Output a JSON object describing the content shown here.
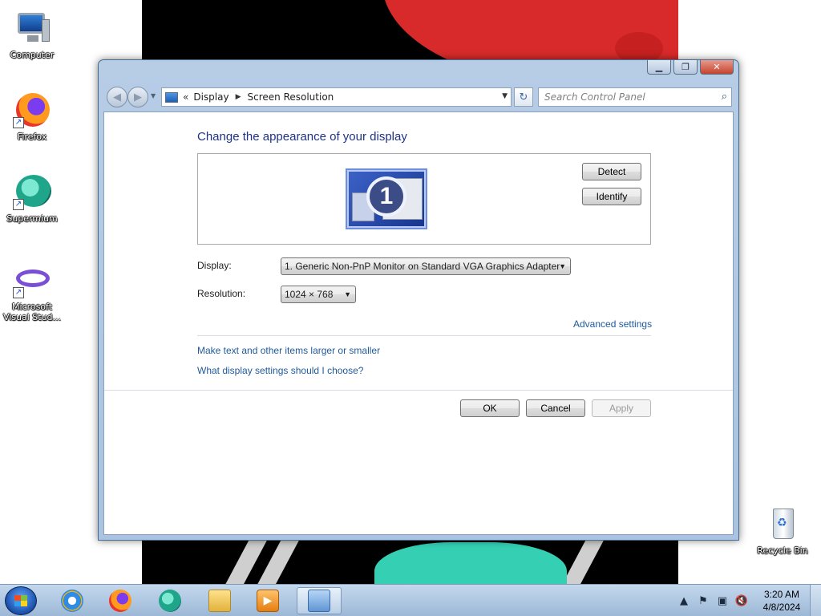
{
  "desktop": {
    "icons": [
      {
        "label": "Computer",
        "icon": "computer-icon"
      },
      {
        "label": "Firefox",
        "icon": "firefox-icon"
      },
      {
        "label": "Supermium",
        "icon": "supermium-icon"
      },
      {
        "label": "Microsoft Visual Stud...",
        "icon": "visual-studio-icon"
      },
      {
        "label": "Recycle Bin",
        "icon": "recycle-bin-icon"
      }
    ]
  },
  "window": {
    "caption_buttons": {
      "minimize": "▁",
      "maximize": "❐",
      "close": "✕"
    },
    "address": {
      "prefix": "«",
      "crumbs": [
        "Display",
        "Screen Resolution"
      ],
      "separator": "▶",
      "dropdown": "▼"
    },
    "refresh_symbol": "↻",
    "search": {
      "placeholder": "Search Control Panel"
    },
    "content": {
      "heading": "Change the appearance of your display",
      "monitor_number": "1",
      "detect_label": "Detect",
      "identify_label": "Identify",
      "display_label": "Display:",
      "display_value": "1. Generic Non-PnP Monitor on Standard VGA Graphics Adapter",
      "resolution_label": "Resolution:",
      "resolution_value": "1024 × 768",
      "advanced_link": "Advanced settings",
      "link_text_size": "Make text and other items larger or smaller",
      "link_help": "What display settings should I choose?",
      "ok_label": "OK",
      "cancel_label": "Cancel",
      "apply_label": "Apply"
    }
  },
  "taskbar": {
    "items": [
      "internet-explorer-icon",
      "firefox-icon",
      "supermium-icon",
      "explorer-folder-icon",
      "media-player-icon",
      "control-panel-icon"
    ],
    "tray": {
      "show_hidden": "▲",
      "flag": "⚑",
      "network": "▣",
      "volume": "🔇"
    },
    "clock": {
      "time": "3:20 AM",
      "date": "4/8/2024"
    }
  },
  "colors": {
    "heading": "#1e3287",
    "link": "#1e5a9d",
    "window_frame": "#b7cde6",
    "wallpaper_red": "#d82a2a",
    "wallpaper_cyan": "#35d0b4"
  }
}
